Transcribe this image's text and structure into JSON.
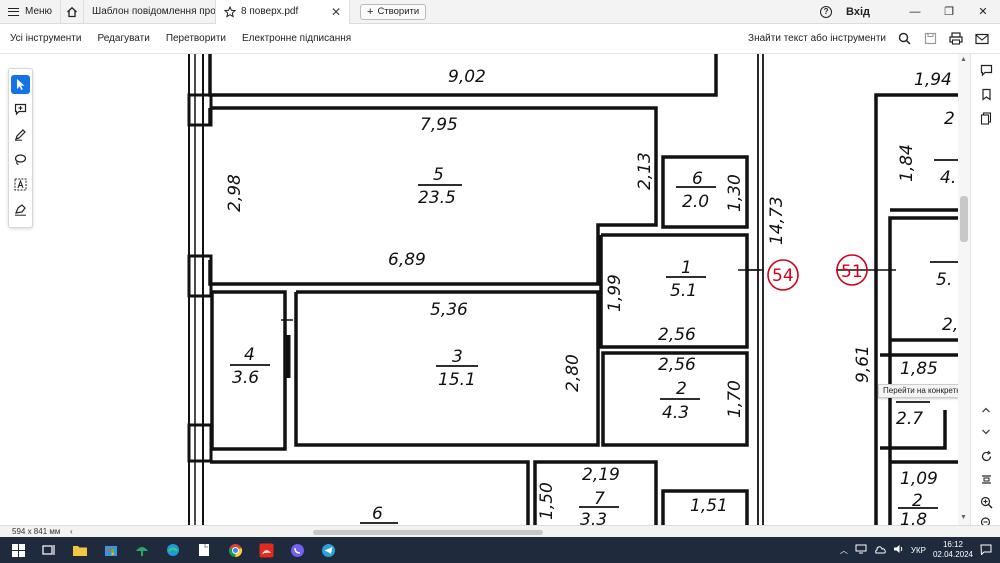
{
  "titlebar": {
    "menu_label": "Меню",
    "tabs": [
      {
        "label": "Шаблон повідомлення про з..."
      },
      {
        "label": "8 поверх.pdf"
      }
    ],
    "create_label": "Створити",
    "login_label": "Вхід"
  },
  "toolbar": {
    "items": [
      "Усі інструменти",
      "Редагувати",
      "Перетворити",
      "Електронне підписання"
    ],
    "search_label": "Знайти текст або інструменти"
  },
  "viewer": {
    "page_number": "1",
    "tooltip": "Перейти на конкретну сторінку",
    "page_size": "594 x 841 мм"
  },
  "plan": {
    "labels": [
      "9,02",
      "7,95",
      "2,98",
      "5",
      "23.5",
      "2,13",
      "6",
      "2.0",
      "1,30",
      "14,73",
      "6,89",
      "1",
      "5.1",
      "1,99",
      "54",
      "5,36",
      "4",
      "3.6",
      "3",
      "15.1",
      "2,80",
      "2,56",
      "2,56",
      "2",
      "4.3",
      "1,70",
      "2,19",
      "1,50",
      "7",
      "3.3",
      "1,51",
      "6",
      "1,94",
      "2",
      "1,84",
      "4.",
      "51",
      "5.",
      "2,",
      "9,61",
      "1,85",
      "2.7",
      "1,09",
      "2",
      "1.8"
    ]
  },
  "taskbar": {
    "language": "УКР",
    "time": "16:12",
    "date": "02.04.2024"
  },
  "colors": {
    "accent": "#1473e6",
    "taskbar": "#1f2a3c",
    "axis_marker": "#d0021b"
  }
}
